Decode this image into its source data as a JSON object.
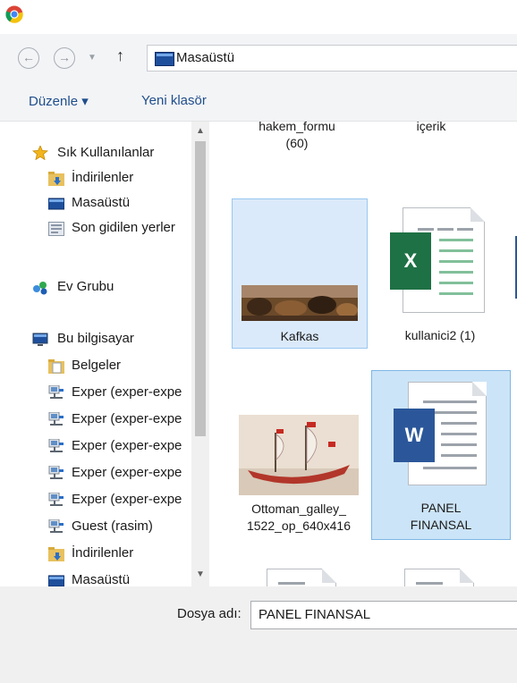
{
  "address": {
    "location": "Masaüstü"
  },
  "commands": {
    "organize": "Düzenle ▾",
    "new_folder": "Yeni klasör"
  },
  "nav": {
    "items": [
      {
        "label": "Sık Kullanılanlar",
        "icon": "star-icon"
      },
      {
        "label": "İndirilenler",
        "icon": "downloads-folder-icon"
      },
      {
        "label": "Masaüstü",
        "icon": "desktop-icon"
      },
      {
        "label": "Son gidilen yerler",
        "icon": "recent-places-icon"
      },
      {
        "label": "Ev Grubu",
        "icon": "homegroup-icon"
      },
      {
        "label": "Bu bilgisayar",
        "icon": "computer-icon"
      },
      {
        "label": "Belgeler",
        "icon": "documents-folder-icon"
      },
      {
        "label": "Exper (exper-expe",
        "icon": "network-drive-icon"
      },
      {
        "label": "Exper (exper-expe",
        "icon": "network-drive-icon"
      },
      {
        "label": "Exper (exper-expe",
        "icon": "network-drive-icon"
      },
      {
        "label": "Exper (exper-expe",
        "icon": "network-drive-icon"
      },
      {
        "label": "Exper (exper-expe",
        "icon": "network-drive-icon"
      },
      {
        "label": "Guest (rasim)",
        "icon": "network-drive-icon"
      },
      {
        "label": "İndirilenler",
        "icon": "downloads-folder-icon"
      },
      {
        "label": "Masaüstü",
        "icon": "desktop-icon"
      }
    ]
  },
  "files": [
    {
      "label": "hakem_formu\n(60)",
      "kind": "document"
    },
    {
      "label": "içerik",
      "kind": "document"
    },
    {
      "label": "Kafkas",
      "kind": "image",
      "selected": "hover"
    },
    {
      "label": "kullanici2 (1)",
      "kind": "excel"
    },
    {
      "label": "Ottoman_galley_\n1522_op_640x416",
      "kind": "image"
    },
    {
      "label": "PANEL\nFINANSAL",
      "kind": "word",
      "selected": "selected"
    }
  ],
  "icons": {
    "excel_letter": "X",
    "word_letter": "W"
  },
  "bottom": {
    "file_name_label": "Dosya adı:",
    "file_name_value": "PANEL FINANSAL"
  },
  "colors": {
    "selection": "#cce4f7",
    "excel": "#1e7145",
    "word": "#2b579a"
  }
}
